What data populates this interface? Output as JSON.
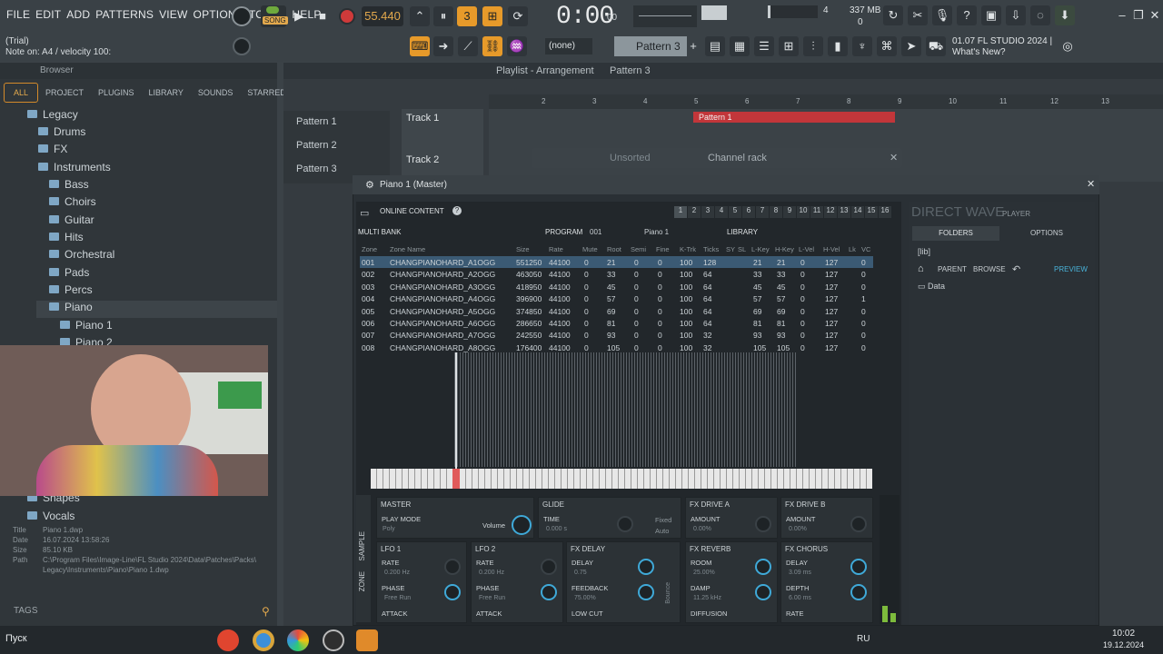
{
  "menu": [
    "FILE",
    "EDIT",
    "ADD",
    "PATTERNS",
    "VIEW",
    "OPTIONS",
    "TOOLS",
    "HELP"
  ],
  "hint": {
    "line1": "(Trial)",
    "line2": "Note on: A4 / velocity 100:"
  },
  "transport": {
    "mode": "SONG",
    "tempo": "55.440",
    "time": "0:00",
    "time_sub": "00",
    "mem": "337 MB",
    "cpu": "4",
    "poly": "0",
    "none": "(none)",
    "pattern": "Pattern 3"
  },
  "news": {
    "l1": "01.07  FL STUDIO 2024 |",
    "l2": "What's New?"
  },
  "browser": {
    "title": "Browser",
    "tabs": [
      "ALL",
      "PROJECT",
      "PLUGINS",
      "LIBRARY",
      "SOUNDS",
      "STARRED"
    ],
    "tree": [
      "Legacy",
      "Drums",
      "FX",
      "Instruments",
      "Bass",
      "Choirs",
      "Guitar",
      "Hits",
      "Orchestral",
      "Pads",
      "Percs",
      "Piano",
      "Piano 1",
      "Piano 2",
      "Shapes",
      "Vocals"
    ],
    "info": {
      "title_k": "Title",
      "title": "Piano 1.dwp",
      "date_k": "Date",
      "date": "16.07.2024 13:58:26",
      "size_k": "Size",
      "size": "85.10 KB",
      "path_k": "Path",
      "path1": "C:\\Program Files\\Image-Line\\FL Studio 2024\\Data\\Patches\\Packs\\",
      "path2": "Legacy\\Instruments\\Piano\\Piano 1.dwp"
    },
    "tags": "TAGS"
  },
  "playlist": {
    "title": "Playlist - Arrangement",
    "pattern": "Pattern 3",
    "patterns": [
      "Pattern 1",
      "Pattern 2",
      "Pattern 3"
    ],
    "tracks": [
      "Track 1",
      "Track 2"
    ],
    "ruler": [
      "2",
      "3",
      "4",
      "5",
      "6",
      "7",
      "8",
      "9",
      "10",
      "11",
      "12",
      "13"
    ],
    "clip": "Pattern 1",
    "rack": "Channel rack",
    "sorted": "Unsorted"
  },
  "plugin": {
    "title": "Piano 1 (Master)",
    "online": "ONLINE CONTENT",
    "multibank": "MULTI BANK",
    "program": "PROGRAM",
    "prog_num": "001",
    "prog_name": "Piano 1",
    "library": "LIBRARY",
    "dw1": "DIRECT WAVE",
    "dw2": "PLAYER",
    "folders": "FOLDERS",
    "options": "OPTIONS",
    "lib": "[lib]",
    "parent": "PARENT",
    "browse": "BROWSE",
    "preview": "PREVIEW",
    "data": "Data",
    "slots": [
      "1",
      "2",
      "3",
      "4",
      "5",
      "6",
      "7",
      "8",
      "9",
      "10",
      "11",
      "12",
      "13",
      "14",
      "15",
      "16"
    ],
    "headers": [
      "Zone",
      "Zone Name",
      "Size",
      "Rate",
      "Mute",
      "Root",
      "Semi",
      "Fine",
      "K-Trk",
      "Ticks",
      "SY",
      "SL",
      "L-Key",
      "H-Key",
      "L-Vel",
      "H-Vel",
      "Lk",
      "VC"
    ],
    "rows": [
      [
        "001",
        "CHANGPIANOHARD_A1OGG",
        "551250",
        "44100",
        "0",
        "21",
        "0",
        "0",
        "100",
        "128",
        "21",
        "21",
        "0",
        "127",
        "0"
      ],
      [
        "002",
        "CHANGPIANOHARD_A2OGG",
        "463050",
        "44100",
        "0",
        "33",
        "0",
        "0",
        "100",
        "64",
        "33",
        "33",
        "0",
        "127",
        "0"
      ],
      [
        "003",
        "CHANGPIANOHARD_A3OGG",
        "418950",
        "44100",
        "0",
        "45",
        "0",
        "0",
        "100",
        "64",
        "45",
        "45",
        "0",
        "127",
        "0"
      ],
      [
        "004",
        "CHANGPIANOHARD_A4OGG",
        "396900",
        "44100",
        "0",
        "57",
        "0",
        "0",
        "100",
        "64",
        "57",
        "57",
        "0",
        "127",
        "1"
      ],
      [
        "005",
        "CHANGPIANOHARD_A5OGG",
        "374850",
        "44100",
        "0",
        "69",
        "0",
        "0",
        "100",
        "64",
        "69",
        "69",
        "0",
        "127",
        "0"
      ],
      [
        "006",
        "CHANGPIANOHARD_A6OGG",
        "286650",
        "44100",
        "0",
        "81",
        "0",
        "0",
        "100",
        "64",
        "81",
        "81",
        "0",
        "127",
        "0"
      ],
      [
        "007",
        "CHANGPIANOHARD_A7OGG",
        "242550",
        "44100",
        "0",
        "93",
        "0",
        "0",
        "100",
        "32",
        "93",
        "93",
        "0",
        "127",
        "0"
      ],
      [
        "008",
        "CHANGPIANOHARD_A8OGG",
        "176400",
        "44100",
        "0",
        "105",
        "0",
        "0",
        "100",
        "32",
        "105",
        "105",
        "0",
        "127",
        "0"
      ]
    ],
    "master": "MASTER",
    "playmode": "PLAY MODE",
    "poly": "Poly",
    "volume": "Volume",
    "glide": "GLIDE",
    "time": "TIME",
    "time_v": "0.000 s",
    "fixed": "Fixed",
    "auto": "Auto",
    "fxa": "FX DRIVE A",
    "fxb": "FX DRIVE B",
    "amount": "AMOUNT",
    "amt_v": "0.00%",
    "lfo1": "LFO 1",
    "lfo2": "LFO 2",
    "rate": "RATE",
    "rate_v": "0.200 Hz",
    "phase": "PHASE",
    "phase_v": "Free Run",
    "attack": "ATTACK",
    "fxdelay": "FX DELAY",
    "delay": "DELAY",
    "delay_v": "0.75",
    "feedback": "FEEDBACK",
    "fb_v": "75.00%",
    "lowcut": "LOW CUT",
    "bounce": "Bounce",
    "fxreverb": "FX REVERB",
    "room": "ROOM",
    "room_v": "25.00%",
    "damp": "DAMP",
    "damp_v": "11.25 kHz",
    "diffusion": "DIFFUSION",
    "fxchorus": "FX CHORUS",
    "cdelay": "DELAY",
    "cdelay_v": "3.09 ms",
    "depth": "DEPTH",
    "depth_v": "6.00 ms",
    "crate": "RATE",
    "sample": "SAMPLE",
    "zone": "ZONE"
  },
  "taskbar": {
    "start": "Пуск",
    "lang": "RU",
    "time": "10:02",
    "date": "19.12.2024"
  }
}
